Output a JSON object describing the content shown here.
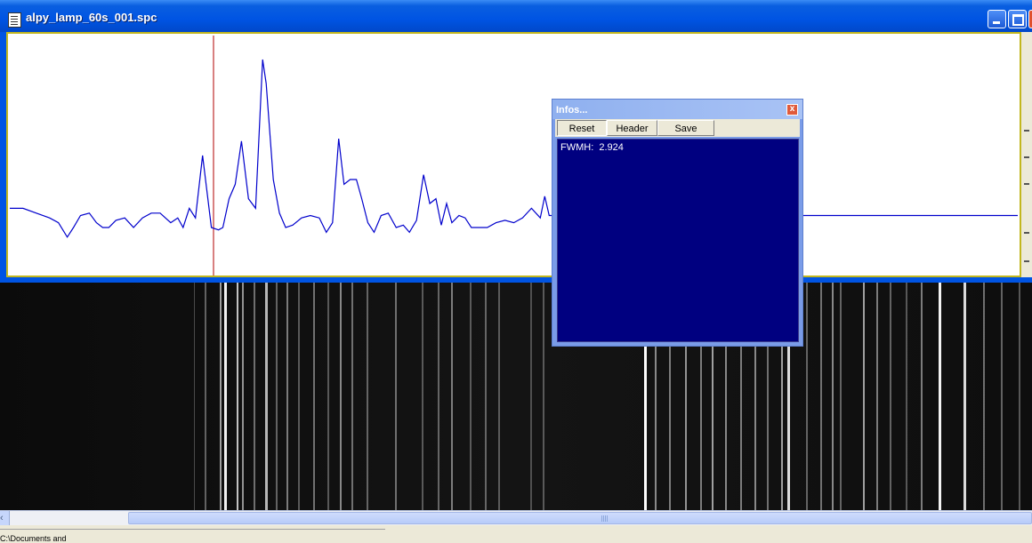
{
  "window": {
    "title": "alpy_lamp_60s_001.spc"
  },
  "infos": {
    "title": "Infos...",
    "close_glyph": "x",
    "buttons": {
      "reset": "Reset",
      "header": "Header",
      "save": "Save"
    },
    "fwmh_text": "FWMH:  2.924"
  },
  "statusbar": {
    "path": "C:\\Documents and"
  },
  "colors": {
    "spectrum_line": "#0000cc",
    "cursor_line": "#b00000",
    "plot_frame": "#c2b71e",
    "infos_body": "#000080",
    "titlebar": "#0054e3"
  },
  "icons": [
    "app-icon",
    "minimize-icon",
    "maximize-icon",
    "close-icon",
    "scroll-left-arrow-icon",
    "scroll-grip-icon"
  ],
  "chart_data": {
    "type": "line",
    "title": "",
    "xlabel": "",
    "ylabel": "",
    "x": [
      0,
      15,
      30,
      45,
      55,
      65,
      72,
      80,
      90,
      98,
      105,
      112,
      120,
      130,
      140,
      150,
      160,
      170,
      182,
      190,
      196,
      203,
      210,
      218,
      228,
      236,
      241,
      248,
      255,
      262,
      270,
      278,
      286,
      290,
      298,
      305,
      312,
      320,
      330,
      340,
      350,
      358,
      365,
      372,
      378,
      385,
      392,
      398,
      405,
      412,
      420,
      428,
      437,
      445,
      452,
      460,
      468,
      475,
      482,
      488,
      494,
      500,
      508,
      515,
      522,
      530,
      540,
      550,
      560,
      570,
      580,
      590,
      600,
      605,
      610,
      1140
    ],
    "values": [
      28,
      28,
      26,
      24,
      22,
      16,
      20,
      25,
      26,
      22,
      20,
      20,
      23,
      24,
      20,
      24,
      26,
      26,
      22,
      24,
      20,
      28,
      24,
      50,
      20,
      19,
      20,
      32,
      38,
      56,
      32,
      28,
      90,
      80,
      40,
      26,
      20,
      21,
      24,
      25,
      24,
      18,
      22,
      57,
      38,
      40,
      40,
      32,
      22,
      18,
      25,
      26,
      20,
      21,
      18,
      23,
      42,
      30,
      32,
      21,
      30,
      22,
      25,
      24,
      20,
      20,
      20,
      22,
      23,
      22,
      24,
      28,
      24,
      33,
      25,
      25
    ],
    "ylim": [
      0,
      100
    ],
    "grid": false
  }
}
